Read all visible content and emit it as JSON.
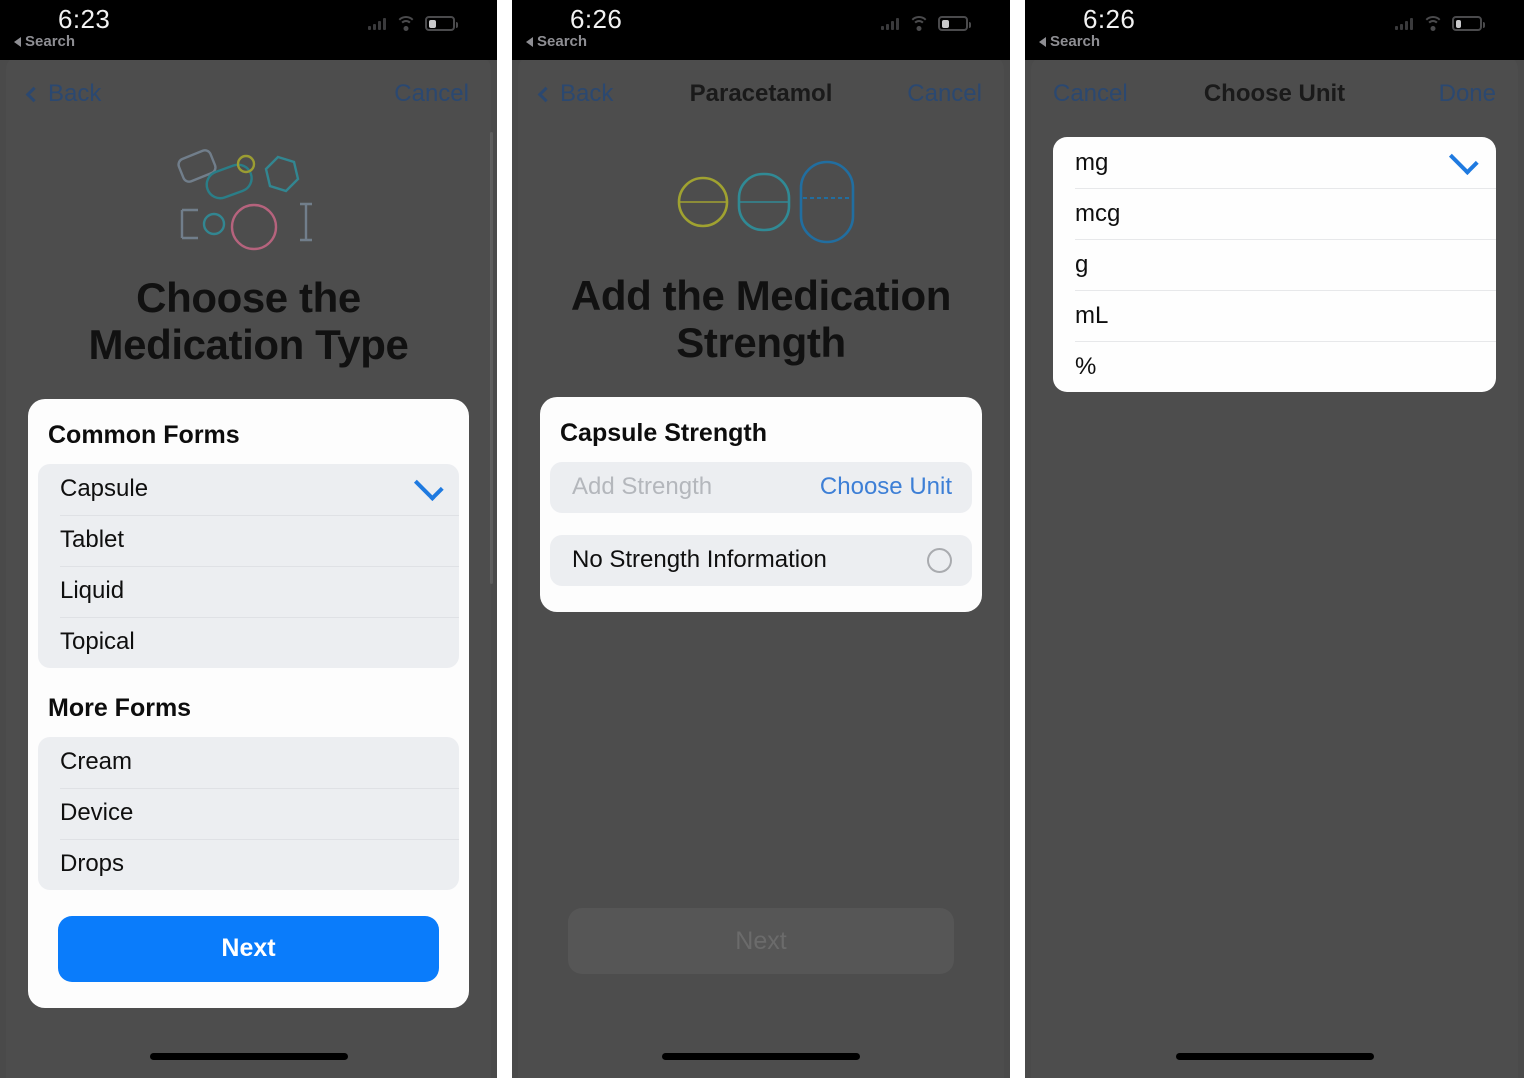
{
  "panels": [
    {
      "status": {
        "time": "6:23",
        "back_label": "Search",
        "battery_pct": 28
      },
      "nav": {
        "back": "Back",
        "title": "",
        "right": "Cancel"
      },
      "hero_icon": "medication-shapes-illustration",
      "title": "Choose the\nMedication Type",
      "title_line1": "Choose the",
      "title_line2": "Medication Type",
      "sections": [
        {
          "heading": "Common Forms",
          "items": [
            {
              "label": "Capsule",
              "selected": true
            },
            {
              "label": "Tablet",
              "selected": false
            },
            {
              "label": "Liquid",
              "selected": false
            },
            {
              "label": "Topical",
              "selected": false
            }
          ]
        },
        {
          "heading": "More Forms",
          "items": [
            {
              "label": "Cream",
              "selected": false
            },
            {
              "label": "Device",
              "selected": false
            },
            {
              "label": "Drops",
              "selected": false
            }
          ]
        }
      ],
      "primary_button": {
        "label": "Next",
        "enabled": true
      }
    },
    {
      "status": {
        "time": "6:26",
        "back_label": "Search",
        "battery_pct": 28
      },
      "nav": {
        "back": "Back",
        "title": "Paracetamol",
        "right": "Cancel"
      },
      "hero_icon": "three-pills-illustration",
      "title_line1": "Add the Medication",
      "title_line2": "Strength",
      "card": {
        "heading": "Capsule Strength",
        "strength_placeholder": "Add Strength",
        "strength_value": "",
        "choose_unit_label": "Choose Unit",
        "no_strength_label": "No Strength Information",
        "no_strength_selected": false
      },
      "primary_button": {
        "label": "Next",
        "enabled": false
      }
    },
    {
      "status": {
        "time": "6:26",
        "back_label": "Search",
        "battery_pct": 22
      },
      "nav": {
        "left": "Cancel",
        "title": "Choose Unit",
        "right": "Done"
      },
      "units": [
        {
          "label": "mg",
          "selected": true
        },
        {
          "label": "mcg",
          "selected": false
        },
        {
          "label": "g",
          "selected": false
        },
        {
          "label": "mL",
          "selected": false
        },
        {
          "label": "%",
          "selected": false
        }
      ]
    }
  ],
  "colors": {
    "accent_blue": "#0a7cfb",
    "link_blue": "#3d7fd6",
    "check_blue": "#1f7ae0",
    "dim_overlay": "#4a4a4a",
    "card_white": "#fdfdfd",
    "group_gray": "#eceef1",
    "pill_yellow": "#b5b82a",
    "pill_teal": "#2a9aa8",
    "pill_blue": "#1777b5",
    "pill_pink": "#d96b8e"
  }
}
